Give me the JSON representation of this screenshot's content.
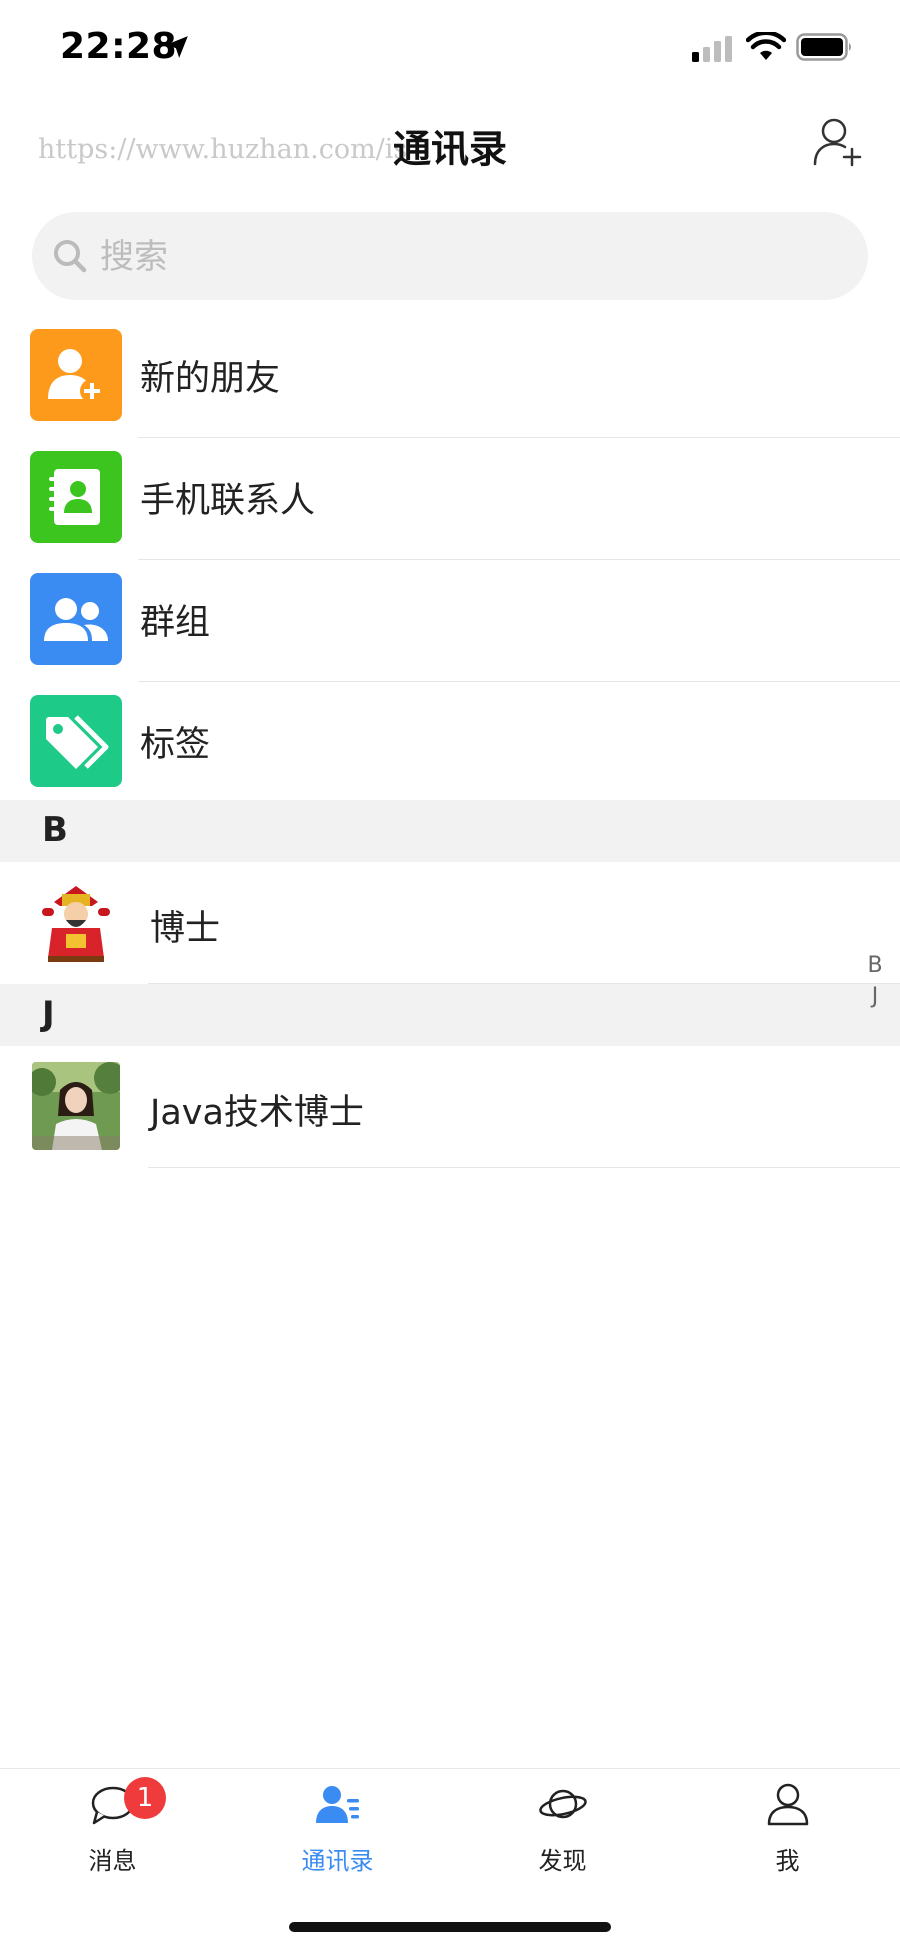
{
  "status_bar": {
    "time": "22:28",
    "icons": [
      "location-arrow-icon",
      "signal-icon",
      "wifi-icon",
      "battery-icon"
    ]
  },
  "nav": {
    "watermark": "https://www.huzhan.com/is",
    "title": "通讯录",
    "right_icon": "add-friend-icon"
  },
  "search": {
    "placeholder": "搜索",
    "value": ""
  },
  "menu": [
    {
      "label": "新的朋友",
      "icon": "new-friend-icon",
      "color": "#fd9a1b"
    },
    {
      "label": "手机联系人",
      "icon": "phone-contacts-icon",
      "color": "#3cc51f"
    },
    {
      "label": "群组",
      "icon": "group-icon",
      "color": "#3b8cf2"
    },
    {
      "label": "标签",
      "icon": "tag-icon",
      "color": "#1dca88"
    }
  ],
  "sections": [
    {
      "letter": "B",
      "contacts": [
        {
          "name": "博士",
          "avatar": "god-of-wealth-avatar"
        }
      ]
    },
    {
      "letter": "J",
      "contacts": [
        {
          "name": "Java技术博士",
          "avatar": "woman-photo-avatar"
        }
      ]
    }
  ],
  "index_bar": [
    "B",
    "J"
  ],
  "tabs": [
    {
      "label": "消息",
      "icon": "message-icon",
      "active": false,
      "badge": "1"
    },
    {
      "label": "通讯录",
      "icon": "contacts-icon",
      "active": true
    },
    {
      "label": "发现",
      "icon": "planet-icon",
      "active": false
    },
    {
      "label": "我",
      "icon": "profile-icon",
      "active": false
    }
  ],
  "colors": {
    "accent": "#3b8cf2",
    "badge": "#ef3b3b",
    "section_bg": "#f2f2f2"
  }
}
